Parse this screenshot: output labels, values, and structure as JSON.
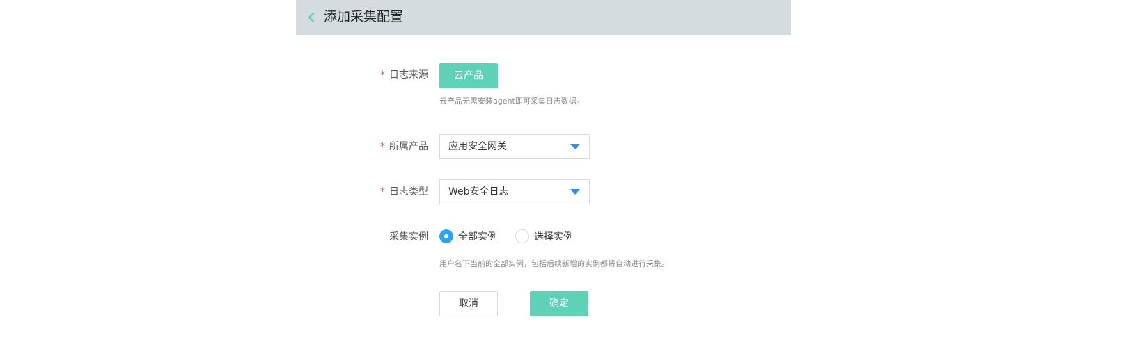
{
  "header": {
    "title": "添加采集配置",
    "back_icon": "chevron-left-icon"
  },
  "form": {
    "required_mark": "*",
    "log_source": {
      "label": "日志来源",
      "button_label": "云产品",
      "hint": "云产品无需安装agent即可采集日志数据。"
    },
    "product": {
      "label": "所属产品",
      "value": "应用安全网关"
    },
    "log_type": {
      "label": "日志类型",
      "value": "Web安全日志"
    },
    "instances": {
      "label": "采集实例",
      "options": [
        {
          "label": "全部实例",
          "selected": true
        },
        {
          "label": "选择实例",
          "selected": false
        }
      ],
      "hint": "用户名下当前的全部实例，包括后续新增的实例都将自动进行采集。"
    },
    "actions": {
      "cancel_label": "取消",
      "confirm_label": "确定"
    }
  },
  "colors": {
    "accent": "#5fd1b6",
    "required": "#e9544b",
    "radio_active": "#2fa4f2",
    "header_bg": "#d5dcdf"
  }
}
